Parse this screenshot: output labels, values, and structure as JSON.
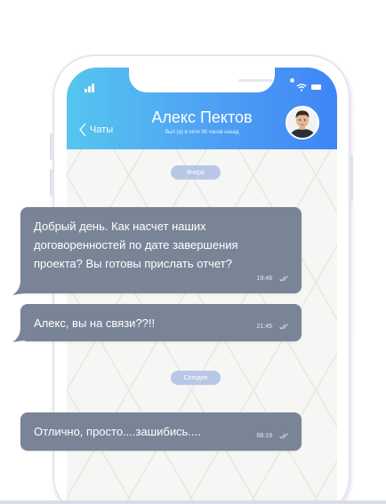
{
  "chat": {
    "back_label": "Чаты",
    "contact_name": "Алекс Пектов",
    "contact_status": "был (а) в сети 98 часов назад"
  },
  "date_dividers": [
    "Вчера",
    "Сегодня"
  ],
  "messages": [
    {
      "lines": [
        "Добрый день. Как насчет наших",
        "договоренностей по дате завершения",
        "проекта? Вы готовы прислать отчет?"
      ],
      "time": "19:48"
    },
    {
      "lines": [
        "Алекс, вы на связи??!!"
      ],
      "time": "21:45"
    },
    {
      "lines": [
        "Отлично, просто....зашибись...."
      ],
      "time": "08:19"
    }
  ],
  "icons": {
    "status_bar": [
      "signal-icon",
      "wifi-icon",
      "battery-icon"
    ],
    "header": [
      "back-chevron-icon",
      "avatar"
    ],
    "message": [
      "double-check-icon"
    ]
  },
  "colors": {
    "header_gradient_start": "#55c6ef",
    "header_gradient_end": "#3f85f6",
    "bubble": "#7a8497",
    "date_pill": "#b9c7e6",
    "chat_background": "#f6f6f4"
  }
}
